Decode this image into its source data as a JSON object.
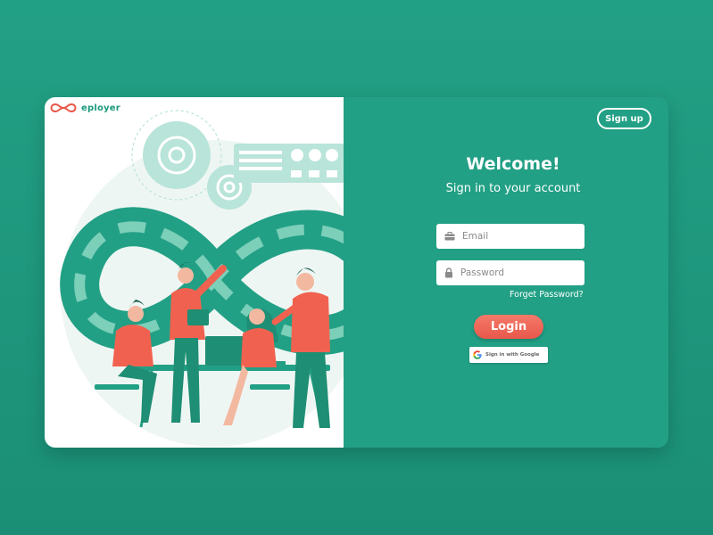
{
  "brand": {
    "name": "eployer",
    "accent": "#e8584a",
    "primary": "#22a085"
  },
  "header": {
    "signup_label": "Sign up"
  },
  "login": {
    "title": "Welcome!",
    "subtitle": "Sign in to your account",
    "email": {
      "placeholder": "Email",
      "icon": "briefcase-icon"
    },
    "password": {
      "placeholder": "Password",
      "icon": "lock-icon"
    },
    "forgot_label": "Forget Password?",
    "login_label": "Login",
    "google_label": "Sign in with Google"
  }
}
